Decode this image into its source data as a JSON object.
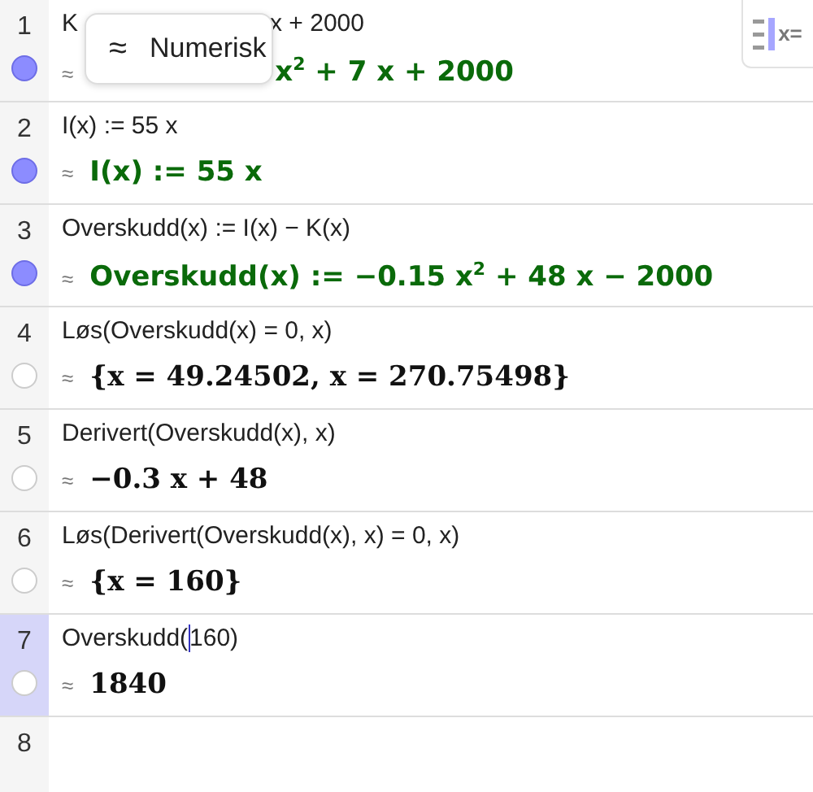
{
  "tooltip": {
    "symbol": "≈",
    "label": "Numerisk"
  },
  "style_bar": {
    "label": "x="
  },
  "rows": [
    {
      "number": "1",
      "selected": false,
      "visible": true,
      "covered_by_tooltip": true,
      "input_parts": [
        "K",
        "x + 2000"
      ],
      "output_mark": "≈",
      "output_parts": [
        "x$^{2}$ + 7 x + 2000"
      ],
      "kind": "definition"
    },
    {
      "number": "2",
      "selected": false,
      "visible": true,
      "input": "I(x) := 55 x",
      "output_mark": "≈",
      "output": "I(x) := 55 x",
      "kind": "definition"
    },
    {
      "number": "3",
      "selected": false,
      "visible": true,
      "input": "Overskudd(x) := I(x) − K(x)",
      "output_mark": "≈",
      "output": "Overskudd(x) := −0.15 x$^{2}$ + 48 x − 2000",
      "kind": "definition"
    },
    {
      "number": "4",
      "selected": false,
      "visible": false,
      "input": "Løs(Overskudd(x) = 0, x)",
      "output_mark": "≈",
      "output": "{x = 49.24502, x = 270.75498}",
      "kind": "result"
    },
    {
      "number": "5",
      "selected": false,
      "visible": false,
      "input": "Derivert(Overskudd(x), x)",
      "output_mark": "≈",
      "output": "−0.3 x + 48",
      "kind": "result"
    },
    {
      "number": "6",
      "selected": false,
      "visible": false,
      "input": "Løs(Derivert(Overskudd(x), x) = 0, x)",
      "output_mark": "≈",
      "output": "{x = 160}",
      "kind": "result"
    },
    {
      "number": "7",
      "selected": true,
      "visible": false,
      "input": "Overskudd(",
      "input_after_cursor": "160)",
      "output_mark": "≈",
      "output": "1840",
      "kind": "result"
    },
    {
      "number": "8",
      "selected": false
    }
  ]
}
